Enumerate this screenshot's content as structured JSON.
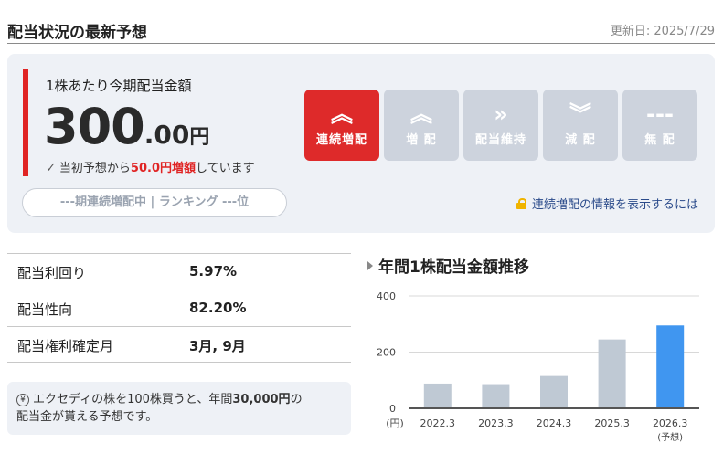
{
  "header": {
    "title": "配当状況の最新予想",
    "updated": "更新日: 2025/7/29"
  },
  "summary": {
    "label": "1株あたり今期配当金額",
    "amount_int": "300",
    "amount_dec": ".00",
    "amount_unit": "円",
    "note_prefix": "当初予想から",
    "note_highlight": "50.0円増額",
    "note_suffix": "しています",
    "pill": "---期連続増配中 | ランキング ---位",
    "lock_text": "連続増配の情報を表示するには"
  },
  "buttons": [
    {
      "icon": "double-chevron-up-icon",
      "glyph": "︽",
      "label": "連続増配",
      "active": true
    },
    {
      "icon": "chevron-up-icon",
      "glyph": "︽",
      "label": "増 配",
      "active": false
    },
    {
      "icon": "double-chevron-right-icon",
      "glyph": "»",
      "label": "配当維持",
      "active": false
    },
    {
      "icon": "chevron-down-icon",
      "glyph": "︾",
      "label": "減 配",
      "active": false
    },
    {
      "icon": "dash-icon",
      "glyph": "---",
      "label": "無 配",
      "active": false
    }
  ],
  "stats": [
    {
      "key": "配当利回り",
      "value": "5.97%"
    },
    {
      "key": "配当性向",
      "value": "82.20%"
    },
    {
      "key": "配当権利確定月",
      "value": "3月, 9月"
    }
  ],
  "info": {
    "prefix": "エクセディの株を100株買うと、年間",
    "amount": "30,000円",
    "suffix": "の",
    "line2": "配当金が貰える予想です。"
  },
  "chart_title": "年間1株配当金額推移",
  "chart_data": {
    "type": "bar",
    "categories": [
      "2022.3",
      "2023.3",
      "2024.3",
      "2025.3",
      "2026.3"
    ],
    "sublabels": [
      "",
      "",
      "",
      "",
      "(予想)"
    ],
    "values": [
      88,
      86,
      115,
      245,
      295
    ],
    "ylim": [
      0,
      400
    ],
    "yticks": [
      0,
      200,
      400
    ],
    "unit_label": "(円)",
    "colors": {
      "actual": "#bfc9d4",
      "forecast": "#4096f0"
    },
    "grid": true
  },
  "colors": {
    "accent": "#de2a2a",
    "inactive": "#cdd3dd",
    "card_bg": "#eef1f6"
  }
}
